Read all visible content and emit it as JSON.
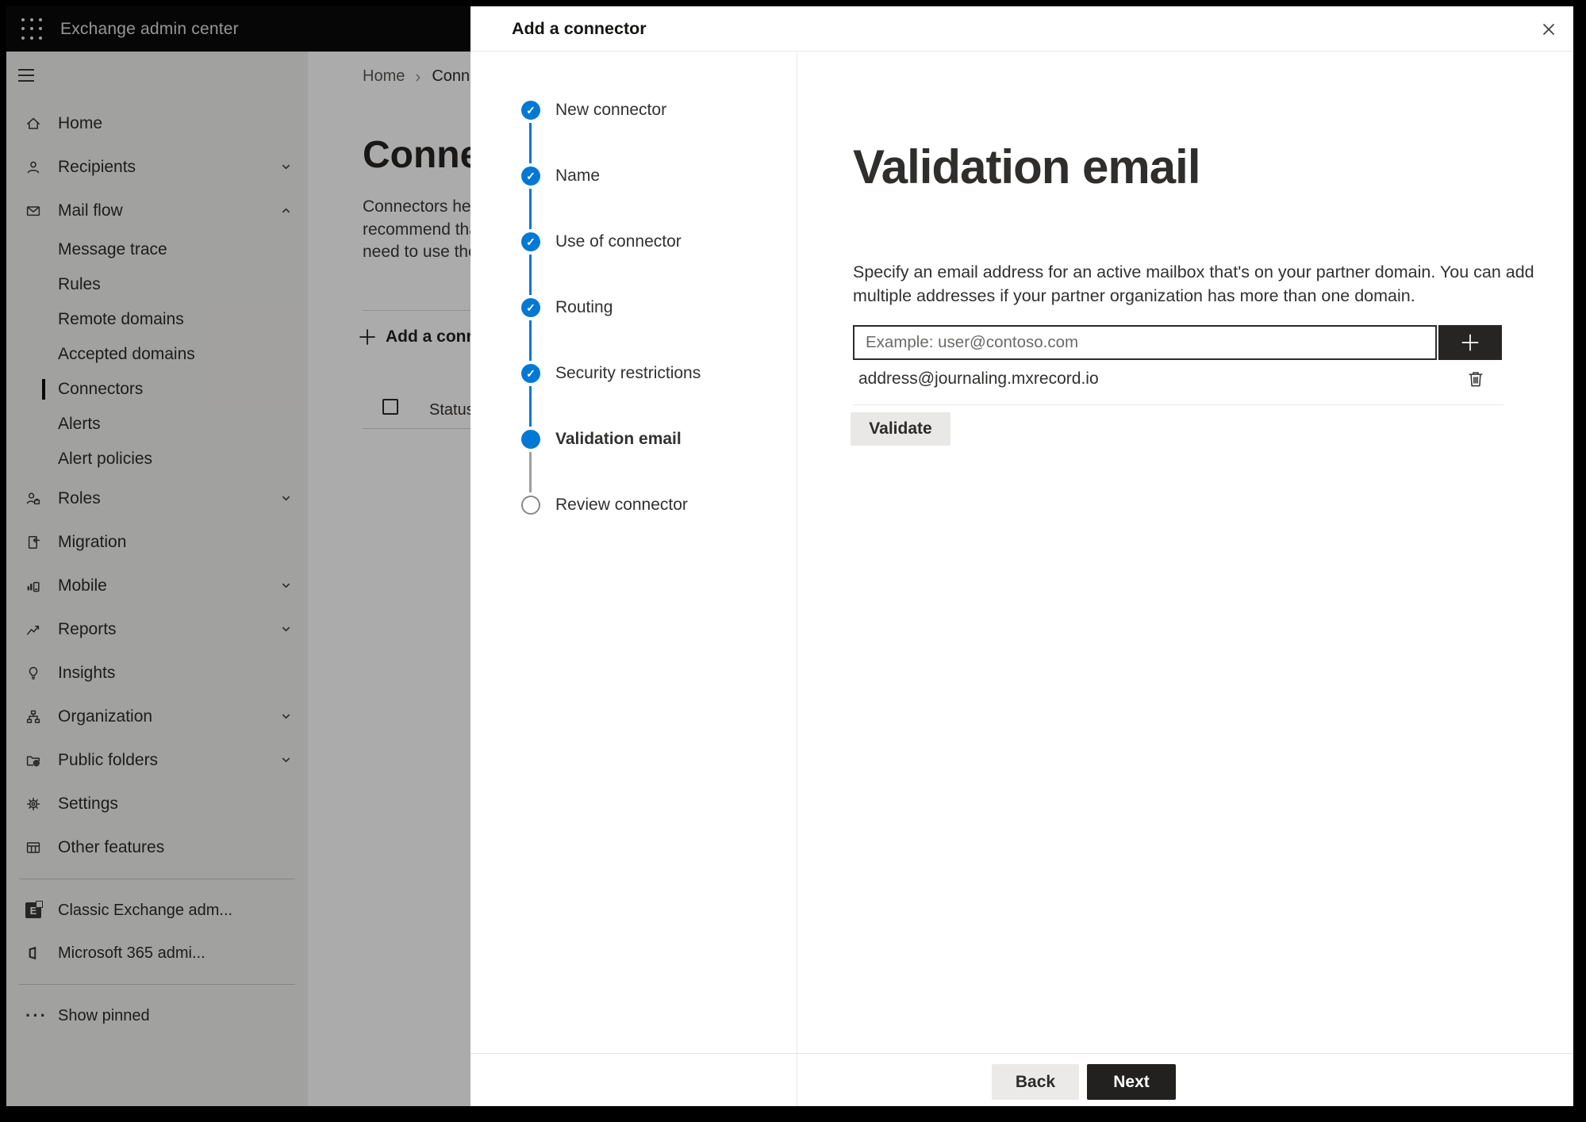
{
  "colors": {
    "accent": "#0078d4",
    "topbar_bg": "#0a0a0a",
    "dark_button": "#222120",
    "plus_button": "#262524",
    "overlay": "rgba(0,0,0,0.33)"
  },
  "topbar": {
    "title": "Exchange admin center",
    "waffle_icon": "app-launcher-icon"
  },
  "sidebar": {
    "items": [
      {
        "label": "Home",
        "icon": "home-icon"
      },
      {
        "label": "Recipients",
        "icon": "person-icon",
        "chevron": "down"
      },
      {
        "label": "Mail flow",
        "icon": "mail-icon",
        "chevron": "up",
        "expanded": true
      },
      {
        "label": "Message trace",
        "sub": true
      },
      {
        "label": "Rules",
        "sub": true
      },
      {
        "label": "Remote domains",
        "sub": true
      },
      {
        "label": "Accepted domains",
        "sub": true
      },
      {
        "label": "Connectors",
        "sub": true,
        "selected": true
      },
      {
        "label": "Alerts",
        "sub": true
      },
      {
        "label": "Alert policies",
        "sub": true
      },
      {
        "label": "Roles",
        "icon": "roles-icon",
        "chevron": "down"
      },
      {
        "label": "Migration",
        "icon": "migration-icon"
      },
      {
        "label": "Mobile",
        "icon": "mobile-icon",
        "chevron": "down"
      },
      {
        "label": "Reports",
        "icon": "reports-icon",
        "chevron": "down"
      },
      {
        "label": "Insights",
        "icon": "lightbulb-icon"
      },
      {
        "label": "Organization",
        "icon": "org-tree-icon",
        "chevron": "down"
      },
      {
        "label": "Public folders",
        "icon": "folder-globe-icon",
        "chevron": "down"
      },
      {
        "label": "Settings",
        "icon": "gear-icon"
      },
      {
        "label": "Other features",
        "icon": "grid-icon"
      }
    ],
    "footer_items": [
      {
        "label": "Classic Exchange adm...",
        "icon": "classic-exchange-icon"
      },
      {
        "label": "Microsoft 365 admi...",
        "icon": "microsoft-365-icon"
      }
    ],
    "pinned_label": "Show pinned"
  },
  "page": {
    "breadcrumb": [
      "Home",
      "Connectors"
    ],
    "title": "Connectors",
    "paragraph_lines": [
      "Connectors help",
      "recommend tha",
      "need to use ther"
    ],
    "add_button_label": "Add a connector",
    "status_header": "Status"
  },
  "dialog": {
    "title": "Add a connector",
    "close_icon": "close-icon",
    "steps": [
      {
        "label": "New connector",
        "state": "done"
      },
      {
        "label": "Name",
        "state": "done"
      },
      {
        "label": "Use of connector",
        "state": "done"
      },
      {
        "label": "Routing",
        "state": "done"
      },
      {
        "label": "Security restrictions",
        "state": "done"
      },
      {
        "label": "Validation email",
        "state": "current"
      },
      {
        "label": "Review connector",
        "state": "todo"
      }
    ],
    "content": {
      "heading": "Validation email",
      "description_lines": [
        "Specify an email address for an active mailbox that's on your partner domain. You can add",
        "multiple addresses if your partner organization has more than one domain."
      ],
      "input_placeholder": "Example: user@contoso.com",
      "addresses": [
        "address@journaling.mxrecord.io"
      ],
      "validate_label": "Validate"
    },
    "footer": {
      "back": "Back",
      "next": "Next"
    }
  }
}
